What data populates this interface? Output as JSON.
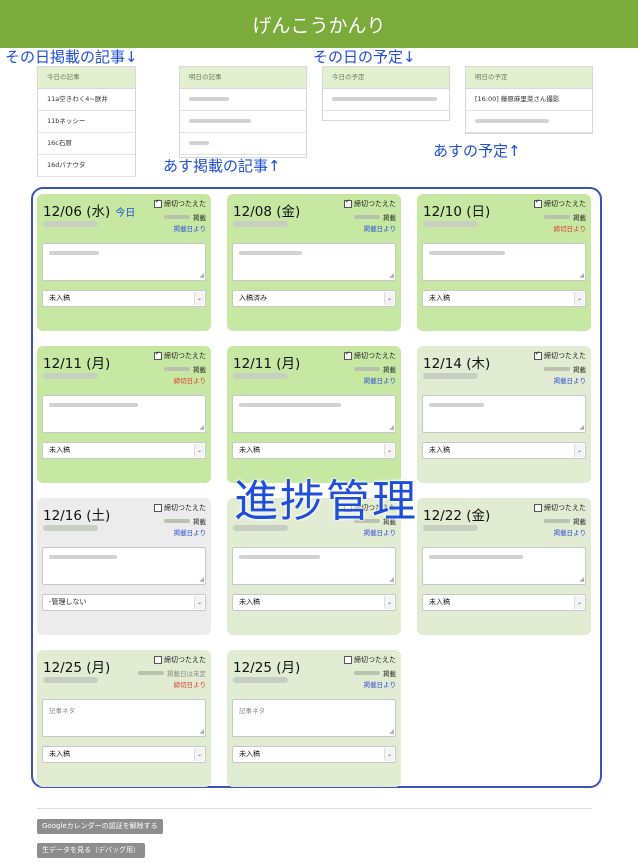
{
  "header": {
    "title": "げんこうかんり"
  },
  "annotations": {
    "today_articles": "その日掲載の記事↓",
    "today_schedule": "その日の予定↓",
    "tomorrow_articles": "あす掲載の記事↑",
    "tomorrow_schedule": "あすの予定↑",
    "progress": "進捗管理"
  },
  "mini_tables": {
    "today_articles": {
      "header": "今日の記事",
      "rows": [
        "11a空きわく4~朕井",
        "11bネッシー",
        "16c石原",
        "16dパナウタ"
      ]
    },
    "tomorrow_articles": {
      "header": "明日の記事"
    },
    "today_schedule": {
      "header": "今日の予定"
    },
    "tomorrow_schedule": {
      "header": "明日の予定",
      "rows": [
        "[16:00] 藤原麻里菜さん撮影"
      ]
    }
  },
  "cards": [
    {
      "date": "12/06 (水)",
      "today_label": "今日",
      "checkbox_label": "締切つたえた",
      "checked": true,
      "status_label": "掲載",
      "link_label": "掲載日より",
      "link_color": "#2b4fd9",
      "memo": "",
      "select": "未入稿",
      "bg": "green"
    },
    {
      "date": "12/08 (金)",
      "checkbox_label": "締切つたえた",
      "checked": true,
      "status_label": "掲載",
      "link_label": "掲載日より",
      "link_color": "#2b4fd9",
      "memo": "",
      "select": "入稿済み",
      "bg": "green"
    },
    {
      "date": "12/10 (日)",
      "checkbox_label": "締切つたえた",
      "checked": true,
      "status_label": "掲載",
      "link_label": "締切日より",
      "link_color": "#e03a2a",
      "memo": "",
      "select": "未入稿",
      "bg": "green"
    },
    {
      "date": "12/11 (月)",
      "checkbox_label": "締切つたえた",
      "checked": true,
      "status_label": "掲載",
      "link_label": "締切日より",
      "link_color": "#e03a2a",
      "memo": "",
      "select": "未入稿",
      "bg": "green"
    },
    {
      "date": "12/11 (月)",
      "checkbox_label": "締切つたえた",
      "checked": true,
      "status_label": "掲載",
      "link_label": "掲載日より",
      "link_color": "#2b4fd9",
      "memo": "",
      "select": "未入稿",
      "bg": "green"
    },
    {
      "date": "12/14 (木)",
      "checkbox_label": "締切つたえた",
      "checked": true,
      "status_label": "掲載",
      "link_label": "掲載日より",
      "link_color": "#2b4fd9",
      "memo": "",
      "select": "未入稿",
      "bg": "pale"
    },
    {
      "date": "12/16 (土)",
      "checkbox_label": "締切つたえた",
      "checked": false,
      "status_label": "掲載",
      "link_label": "掲載日より",
      "link_color": "#2b4fd9",
      "memo": "",
      "select": "-管理しない",
      "bg": "gray"
    },
    {
      "date": "",
      "checkbox_label": "締切つたえた",
      "checked": false,
      "status_label": "掲載",
      "link_label": "掲載日より",
      "link_color": "#2b4fd9",
      "memo": "",
      "select": "未入稿",
      "bg": "pale"
    },
    {
      "date": "12/22 (金)",
      "checkbox_label": "締切つたえた",
      "checked": false,
      "status_label": "掲載",
      "link_label": "掲載日より",
      "link_color": "#2b4fd9",
      "memo": "",
      "select": "未入稿",
      "bg": "pale"
    },
    {
      "date": "12/25 (月)",
      "checkbox_label": "締切つたえた",
      "checked": false,
      "status_label": "掲載日は未定",
      "link_label": "締切日より",
      "link_color": "#e03a2a",
      "memo": "記事ネタ",
      "select": "未入稿",
      "bg": "pale"
    },
    {
      "date": "12/25 (月)",
      "checkbox_label": "締切つたえた",
      "checked": false,
      "status_label": "掲載",
      "link_label": "掲載日より",
      "link_color": "#2b4fd9",
      "memo": "記事ネタ",
      "select": "未入稿",
      "bg": "pale"
    }
  ],
  "buttons": {
    "google_auth": "Googleカレンダーの認証を解除する",
    "raw_data": "生データを見る（デバッグ用）"
  }
}
